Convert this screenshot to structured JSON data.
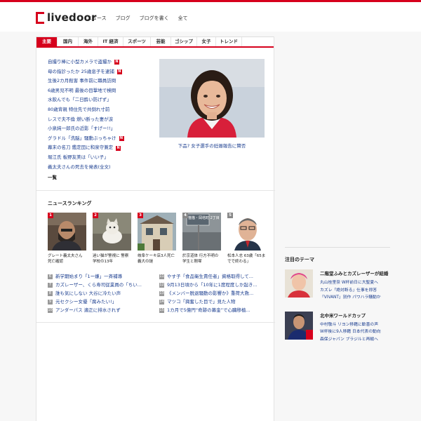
{
  "header": {
    "logo": "livedoor",
    "nav": [
      "ニュース",
      "ブログ",
      "ブログを書く",
      "全て"
    ]
  },
  "tabs": [
    "主要",
    "国内",
    "海外",
    "IT 経済",
    "スポーツ",
    "芸能",
    "ゴシップ",
    "女子",
    "トレンド"
  ],
  "news": [
    {
      "text": "自撮り棒に小型カメラで盗撮か",
      "new": true
    },
    {
      "text": "母の指診ったか 25歳息子を逮捕",
      "new": true
    },
    {
      "text": "生後2カ月殺害 事件前に職員訪問",
      "new": false
    },
    {
      "text": "6歳男児不明 最後の目撃地で検問",
      "new": false
    },
    {
      "text": "水飲んでも「二日酔い防げず」",
      "new": false
    },
    {
      "text": "80歳背親 特住先で共倒れ寸前",
      "new": false
    },
    {
      "text": "レスで夫不倫 燃い断った妻が涙",
      "new": false
    },
    {
      "text": "小泉純一郎氏の近影「すげー!!」",
      "new": false
    },
    {
      "text": "グラドル「洗脳」騒動ぶっちゃけ",
      "new": true
    },
    {
      "text": "幕末の名刀 鑑定団に和泉守兼定",
      "new": true
    },
    {
      "text": "堀江氏 板野友美は「いい子」",
      "new": false
    },
    {
      "text": "義太夫さんの死去を発表(全文)",
      "new": false
    }
  ],
  "news_more": "一覧",
  "feature": {
    "caption": "下品? 女子選手の妊娠報告に賛否"
  },
  "ranking": {
    "title": "ニュースランキング",
    "cards": [
      {
        "rank": "1",
        "caption": "グレート義太夫さん 死亡確認"
      },
      {
        "rank": "2",
        "caption": "迷い猫が警視に 警察学校の13年"
      },
      {
        "rank": "3",
        "caption": "岐阜ケーキ店3人死亡 義大の謎"
      },
      {
        "rank": "4",
        "caption": "於京道体 行方不明の学生と剛塚",
        "sign": "猫猫・岡塔町 2丁目"
      },
      {
        "rank": "5",
        "caption": "松本人志 63歳「65までで終わる」"
      }
    ],
    "left": [
      {
        "rank": "6",
        "text": "新学期始まり「1ー嫌」一斉補導"
      },
      {
        "rank": "7",
        "text": "カズレーザー、くら寿司従業員の「ちい..."
      },
      {
        "rank": "8",
        "text": "誰も気にしない 大谷に冷たい声"
      },
      {
        "rank": "9",
        "text": "元セクシー女優「腐みたい!」"
      },
      {
        "rank": "10",
        "text": "アンダーパス 適正に排水されず"
      }
    ],
    "right": [
      {
        "rank": "11",
        "text": "やす子「食品衛生責任者」資格取得して..."
      },
      {
        "rank": "12",
        "text": "9月13日頃から「10年に1度程度しか起き..."
      },
      {
        "rank": "13",
        "text": "《メンバー脱退騒動の影響か》重荷大救..."
      },
      {
        "rank": "14",
        "text": "マツコ「興奮した目で」見た人物"
      },
      {
        "rank": "15",
        "text": "1カ月で5億円“奇跡の募金”で心臓移植..."
      }
    ]
  },
  "side": {
    "title": "注目のテーマ",
    "blocks": [
      {
        "head": "二階堂ふみとカズレーザーが結婚",
        "links": [
          "丸山桂里奈 W杯前日に大聖夏へ",
          "カズレ「絶対断る」仕事を即答",
          "「VIVANT」別作 パワハラ騒動か"
        ]
      },
      {
        "head": "北中米ワールドカップ",
        "links": [
          "中村敬斗 リヨン移籍に歓喜の声",
          "W杯後に9人移籍 日本代表の動向",
          "森保ジャパン ブラジルと再戦へ"
        ]
      }
    ]
  },
  "colors": {
    "accent": "#d6001c",
    "link": "#1a3d8f"
  }
}
